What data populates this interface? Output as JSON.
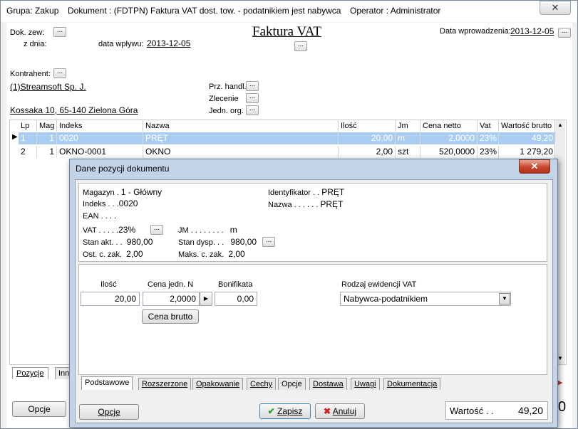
{
  "titlebar": {
    "group": "Grupa: Zakup",
    "document": "Dokument : (FDTPN) Faktura VAT dost. tow. - podatnikiem jest nabywca",
    "operator": "Operator : Administrator",
    "close": "✕"
  },
  "header": {
    "title": "Faktura VAT",
    "dok_zew_label": "Dok. zew:",
    "z_dnia_label": "z dnia:",
    "data_wplywu_label": "data wpływu:",
    "data_wplywu_value": "2013-12-05",
    "data_wprowadzenia_label": "Data wprowadzenia:",
    "data_wprowadzenia_value": "2013-12-05",
    "kontrahent_label": "Kontrahent:",
    "kontrahent_name": "(1)Streamsoft Sp. J.",
    "kontrahent_address": "Kossaka 10, 65-140 Zielona Góra",
    "prz_handl_label": "Prz. handl.",
    "zlecenie_label": "Zlecenie",
    "jedn_org_label": "Jedn. org.",
    "dots": "..."
  },
  "grid": {
    "columns": [
      "Lp",
      "Mag",
      "Indeks",
      "Nazwa",
      "Ilość",
      "Jm",
      "Cena netto",
      "Vat",
      "Wartość brutto"
    ],
    "rows": [
      {
        "lp": "1",
        "mag": "1",
        "indeks": "0020",
        "nazwa": "PRĘT",
        "ilosc": "20,00",
        "jm": "m",
        "cena": "2,0000",
        "vat": "23%",
        "wartosc": "49,20"
      },
      {
        "lp": "2",
        "mag": "1",
        "indeks": "OKNO-0001",
        "nazwa": "OKNO",
        "ilosc": "2,00",
        "jm": "szt",
        "cena": "520,0000",
        "vat": "23%",
        "wartosc": "1 279,20"
      }
    ]
  },
  "bottom": {
    "tab_pozycje": "Pozycje",
    "tab_inne": "Inn",
    "opcje_button": "Opcje",
    "right_digit": "0"
  },
  "dialog": {
    "title": "Dane pozycji dokumentu",
    "magazyn_label": "Magazyn",
    "magazyn_value": "1 - Główny",
    "indeks_label": "Indeks",
    "indeks_value": "0020",
    "ean_label": "EAN",
    "vat_label": "VAT",
    "vat_value": "23%",
    "jm_label": "JM",
    "jm_value": "m",
    "stan_akt_label": "Stan akt.",
    "stan_akt_value": "980,00",
    "stan_dysp_label": "Stan dysp.",
    "stan_dysp_value": "980,00",
    "ost_c_zak_label": "Ost. c. zak.",
    "ost_c_zak_value": "2,00",
    "maks_c_zak_label": "Maks. c. zak.",
    "maks_c_zak_value": "2,00",
    "identyfikator_label": "Identyfikator",
    "identyfikator_value": "PRĘT",
    "nazwa_label": "Nazwa",
    "nazwa_value": "PRĘT",
    "ilosc_label": "Ilość",
    "ilosc_value": "20,00",
    "cena_jedn_label": "Cena jedn. N",
    "cena_jedn_value": "2,0000",
    "bonifikata_label": "Bonifikata",
    "bonifikata_value": "0,00",
    "rodzaj_label": "Rodzaj ewidencji VAT",
    "rodzaj_value": "Nabywca-podatnikiem",
    "cena_brutto_button": "Cena brutto",
    "tabs": [
      "Podstawowe",
      "Rozszerzone",
      "Opakowanie",
      "Cechy",
      "Opcje",
      "Dostawa",
      "Uwagi",
      "Dokumentacja"
    ],
    "opcje_button": "Opcje",
    "zapisz_button": "Zapisz",
    "anuluj_button": "Anuluj",
    "wartosc_label": "Wartość",
    "wartosc_value": "49,20",
    "close": "✕"
  }
}
